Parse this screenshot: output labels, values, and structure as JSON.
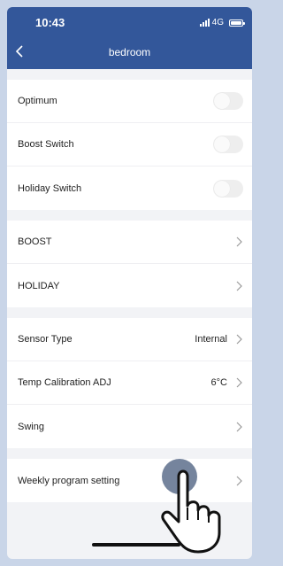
{
  "status_bar": {
    "time": "10:43",
    "network": "4G"
  },
  "header": {
    "title": "bedroom",
    "accent_color": "#33579a"
  },
  "sections": [
    [
      {
        "label": "Optimum",
        "type": "toggle",
        "on": false
      },
      {
        "label": "Boost Switch",
        "type": "toggle",
        "on": false
      },
      {
        "label": "Holiday Switch",
        "type": "toggle",
        "on": false
      }
    ],
    [
      {
        "label": "BOOST",
        "type": "link"
      },
      {
        "label": "HOLIDAY",
        "type": "link"
      }
    ],
    [
      {
        "label": "Sensor Type",
        "type": "link",
        "value": "Internal"
      },
      {
        "label": "Temp Calibration ADJ",
        "type": "link",
        "value": "6°C"
      },
      {
        "label": "Swing",
        "type": "link"
      }
    ],
    [
      {
        "label": "Weekly program setting",
        "type": "link"
      }
    ]
  ],
  "icons": [
    "chevron-left-icon",
    "chevron-right-icon",
    "signal-icon",
    "battery-icon",
    "pointing-hand-icon"
  ]
}
